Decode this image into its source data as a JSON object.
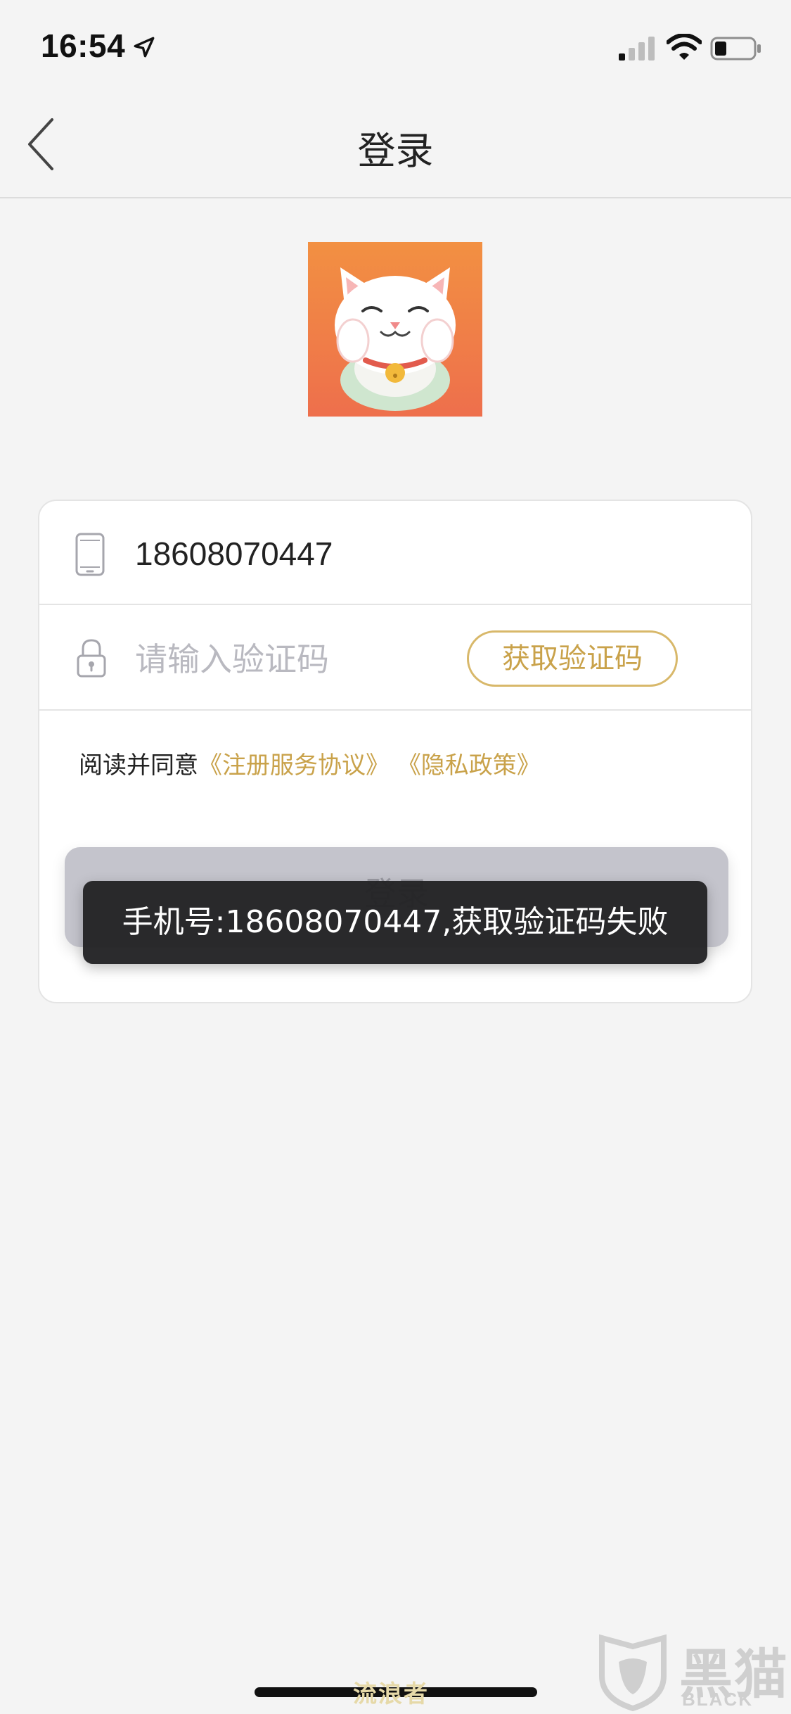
{
  "status_bar": {
    "time": "16:54",
    "icons": [
      "location-arrow-icon",
      "cellular-signal-icon",
      "wifi-icon",
      "battery-icon"
    ]
  },
  "nav": {
    "title": "登录",
    "back_icon": "chevron-left-icon"
  },
  "logo": {
    "icon": "lucky-cat-logo"
  },
  "form": {
    "phone": {
      "icon": "phone-icon",
      "value": "18608070447"
    },
    "code": {
      "icon": "lock-icon",
      "placeholder": "请输入验证码",
      "value": ""
    },
    "get_code_label": "获取验证码",
    "agreement": {
      "prefix": "阅读并同意",
      "terms_link": "《注册服务协议》",
      "privacy_link": "《隐私政策》"
    },
    "login_label": "登录"
  },
  "toast": "手机号:18608070447,获取验证码失败",
  "watermark": {
    "center_text": "流浪者",
    "brand_cn": "黑猫",
    "brand_en": "BLACK CAT"
  },
  "colors": {
    "accent_gold": "#c9a24a",
    "logo_orange": "#f07a3e",
    "background": "#f4f4f4",
    "toast_bg": "#222224"
  }
}
